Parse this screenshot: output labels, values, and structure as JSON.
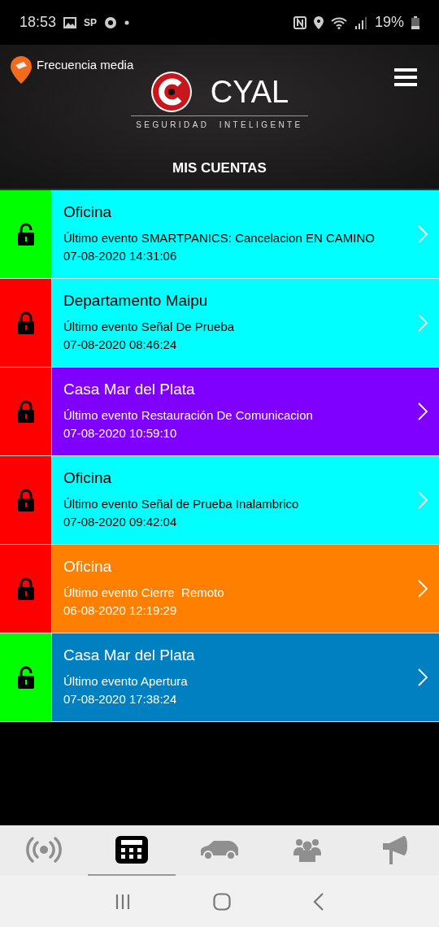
{
  "status_bar": {
    "time": "18:53",
    "carrier": "SP",
    "battery": "19%"
  },
  "header": {
    "location_label": "Frecuencia media",
    "brand": "CYAL",
    "tagline": "SEGURIDAD  INTELIGENTE"
  },
  "title": "MIS CUENTAS",
  "accounts": [
    {
      "name": "Oficina",
      "event": "Último evento SMARTPANICS: Cancelacion EN CAMINO",
      "date": "07-08-2020 14:31:06",
      "armed": false,
      "color": "#00ffff"
    },
    {
      "name": "Departamento Maipu",
      "event": "Último evento Señal De Prueba",
      "date": "07-08-2020 08:46:24",
      "armed": true,
      "color": "#00ffff"
    },
    {
      "name": "Casa Mar del Plata",
      "event": "Último evento Restauración De Comunicacion",
      "date": "07-08-2020 10:59:10",
      "armed": true,
      "color": "#8000ff"
    },
    {
      "name": "Oficina",
      "event": "Último evento Señal de Prueba Inalambrico",
      "date": "07-08-2020 09:42:04",
      "armed": true,
      "color": "#00ffff"
    },
    {
      "name": "Oficina",
      "event": "Último evento Cierre  Remoto",
      "date": "06-08-2020 12:19:29",
      "armed": true,
      "color": "#ff8000"
    },
    {
      "name": "Casa Mar del Plata",
      "event": "Último evento Apertura",
      "date": "07-08-2020 17:38:24",
      "armed": false,
      "color": "#0080c0"
    }
  ],
  "tabs": [
    {
      "kind": "signal",
      "selected": false
    },
    {
      "kind": "keypad",
      "selected": true
    },
    {
      "kind": "car",
      "selected": false
    },
    {
      "kind": "group",
      "selected": false
    },
    {
      "kind": "megaphone",
      "selected": false
    }
  ]
}
